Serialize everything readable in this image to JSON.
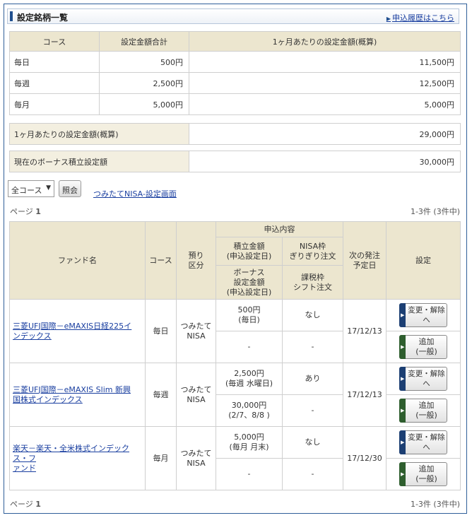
{
  "header": {
    "title": "設定銘柄一覧",
    "history_link": "申込履歴はこちら"
  },
  "summary": {
    "headers": [
      "コース",
      "設定金額合計",
      "1ヶ月あたりの設定金額(概算)"
    ],
    "rows": [
      {
        "course": "毎日",
        "total": "500円",
        "monthly": "11,500円"
      },
      {
        "course": "毎週",
        "total": "2,500円",
        "monthly": "12,500円"
      },
      {
        "course": "毎月",
        "total": "5,000円",
        "monthly": "5,000円"
      }
    ],
    "monthly_total_label": "1ヶ月あたりの設定金額(概算)",
    "monthly_total_value": "29,000円",
    "bonus_label": "現在のボーナス積立設定額",
    "bonus_value": "30,000円"
  },
  "controls": {
    "course_select": "全コース",
    "query_button": "照会",
    "nisa_link": "つみたてNISA-設定画面"
  },
  "pagination": {
    "page_label": "ページ",
    "page_number": "1",
    "count": "1-3件 (3件中)"
  },
  "table": {
    "headers": {
      "fund": "ファンド名",
      "course": "コース",
      "custody_1": "預り",
      "custody_2": "区分",
      "application": "申込内容",
      "amount_1": "積立金額",
      "amount_2": "(申込設定日)",
      "nisa_1": "NISA枠",
      "nisa_2": "ぎりぎり注文",
      "bonus_1": "ボーナス",
      "bonus_2": "設定金額",
      "bonus_3": "(申込設定日)",
      "taxable_1": "課税枠",
      "taxable_2": "シフト注文",
      "next_1": "次の発注",
      "next_2": "予定日",
      "settings": "設定"
    },
    "rows": [
      {
        "fund_1": "三菱UFJ国際－eMAXIS日経225イ",
        "fund_2": "ンデックス",
        "course": "毎日",
        "custody_1": "つみたて",
        "custody_2": "NISA",
        "amount_1": "500円",
        "amount_2": "(毎日)",
        "nisa": "なし",
        "bonus_1": "-",
        "bonus_2": "",
        "taxable": "-",
        "next_date": "17/12/13",
        "change_button": "変更・解除へ",
        "add_button_1": "追加",
        "add_button_2": "(一般)"
      },
      {
        "fund_1": "三菱UFJ国際－eMAXIS Slim 新興",
        "fund_2": "国株式インデックス",
        "course": "毎週",
        "custody_1": "つみたて",
        "custody_2": "NISA",
        "amount_1": "2,500円",
        "amount_2": "(毎週 水曜日)",
        "nisa": "あり",
        "bonus_1": "30,000円",
        "bonus_2": "(2/7、8/8 )",
        "taxable": "-",
        "next_date": "17/12/13",
        "change_button": "変更・解除へ",
        "add_button_1": "追加",
        "add_button_2": "(一般)"
      },
      {
        "fund_1": "楽天－楽天・全米株式インデックス・フ",
        "fund_2": "ァンド",
        "course": "毎月",
        "custody_1": "つみたて",
        "custody_2": "NISA",
        "amount_1": "5,000円",
        "amount_2": "(毎月 月末)",
        "nisa": "なし",
        "bonus_1": "-",
        "bonus_2": "",
        "taxable": "-",
        "next_date": "17/12/30",
        "change_button": "変更・解除へ",
        "add_button_1": "追加",
        "add_button_2": "(一般)"
      }
    ]
  },
  "colors": {
    "header_bg": "#ece6cf",
    "link": "#1a3fa0",
    "change_tab": "#1c3f73",
    "add_tab": "#2e5e2e"
  },
  "icons": {
    "history_link": "triangle-right-icon",
    "select": "caret-down-icon",
    "button_tab": "triangle-right-icon"
  }
}
